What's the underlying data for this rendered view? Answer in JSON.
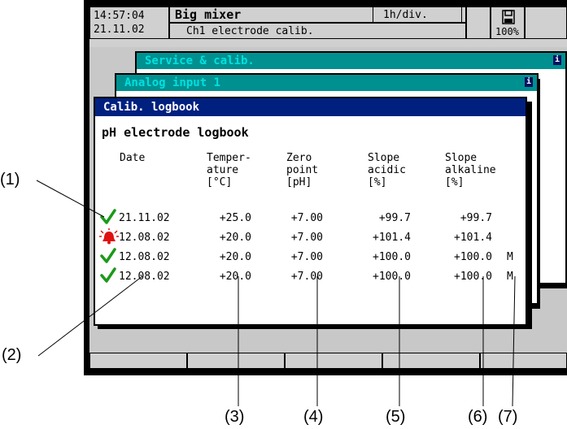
{
  "header": {
    "time": "14:57:04",
    "date": "21.11.02",
    "title": "Big mixer",
    "subtitle": "Ch1 electrode calib.",
    "timebase": "1h/div.",
    "memory": "100%"
  },
  "windows": {
    "service": "Service & calib.",
    "analog": "Analog input 1",
    "logbook": "Calib. logbook"
  },
  "logbook": {
    "heading": "pH electrode logbook",
    "columns": {
      "date": "Date",
      "temp": "Temper-\nature\n[°C]",
      "zero": "Zero\npoint\n[pH]",
      "acid": "Slope\nacidic\n[%]",
      "alk": "Slope\nalkaline\n[%]"
    },
    "rows": [
      {
        "status": "check",
        "date": "21.11.02",
        "temp": "+25.0",
        "zero": "+7.00",
        "acid": "+99.7",
        "alk": "+99.7",
        "flag": ""
      },
      {
        "status": "alarm",
        "date": "12.08.02",
        "temp": "+20.0",
        "zero": "+7.00",
        "acid": "+101.4",
        "alk": "+101.4",
        "flag": ""
      },
      {
        "status": "check",
        "date": "12.08.02",
        "temp": "+20.0",
        "zero": "+7.00",
        "acid": "+100.0",
        "alk": "+100.0",
        "flag": "M"
      },
      {
        "status": "check",
        "date": "12.08.02",
        "temp": "+20.0",
        "zero": "+7.00",
        "acid": "+100.0",
        "alk": "+100.0",
        "flag": "M"
      }
    ]
  },
  "callouts": [
    "(1)",
    "(2)",
    "(3)",
    "(4)",
    "(5)",
    "(6)",
    "(7)"
  ],
  "colors": {
    "teal": "#009090",
    "navy": "#002080",
    "check": "#1a9a1a",
    "alarm": "#e01010"
  }
}
